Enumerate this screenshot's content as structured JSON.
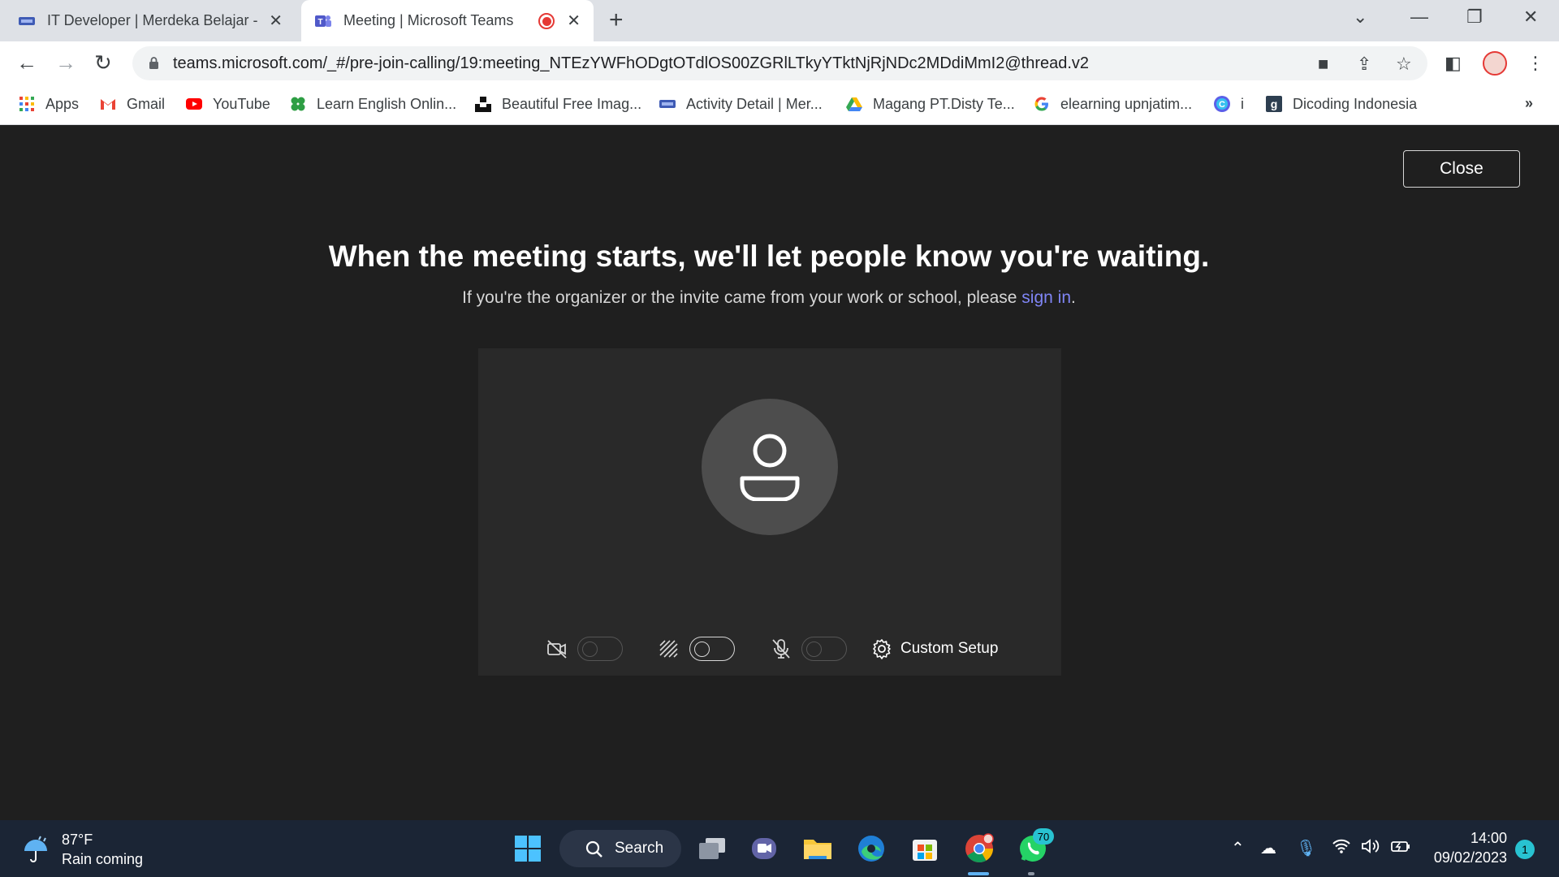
{
  "browser": {
    "tabs": [
      {
        "title": "IT Developer | Merdeka Belajar -"
      },
      {
        "title": "Meeting | Microsoft Teams"
      }
    ],
    "url": "teams.microsoft.com/_#/pre-join-calling/19:meeting_NTEzYWFhODgtOTdlOS00ZGRlLTkyYTktNjRjNDc2MDdiMmI2@thread.v2",
    "bookmarks": [
      {
        "label": "Apps",
        "icon": "apps-grid-icon"
      },
      {
        "label": "Gmail",
        "icon": "gmail-icon"
      },
      {
        "label": "YouTube",
        "icon": "youtube-icon"
      },
      {
        "label": "Learn English Onlin...",
        "icon": "clover-icon"
      },
      {
        "label": "Beautiful Free Imag...",
        "icon": "unsplash-icon"
      },
      {
        "label": "Activity Detail | Mer...",
        "icon": "kampus-merdeka-icon"
      },
      {
        "label": "Magang PT.Disty Te...",
        "icon": "google-drive-icon"
      },
      {
        "label": "elearning upnjatim...",
        "icon": "google-icon"
      },
      {
        "label": "i",
        "icon": "circle-c-icon"
      },
      {
        "label": "Dicoding Indonesia",
        "icon": "dicoding-icon"
      }
    ],
    "more_bookmarks": "»"
  },
  "teams": {
    "close_label": "Close",
    "headline": "When the meeting starts, we'll let people know you're waiting.",
    "subline_prefix": "If you're the organizer or the invite came from your work or school, please ",
    "subline_link": "sign in",
    "subline_suffix": ".",
    "controls": {
      "camera_on": false,
      "background_blur_on": false,
      "mic_on": false,
      "custom_setup_label": "Custom Setup"
    }
  },
  "taskbar": {
    "weather_temp": "87°F",
    "weather_cond": "Rain coming",
    "search_label": "Search",
    "whatsapp_badge": "70",
    "time": "14:00",
    "date": "09/02/2023",
    "notifications": "1"
  },
  "colors": {
    "link": "#7f85f5",
    "teams_bg": "#1f1f1f",
    "preview_bg": "#292929",
    "taskbar_bg": "#1b2535",
    "accent_badge": "#28c2d1"
  }
}
